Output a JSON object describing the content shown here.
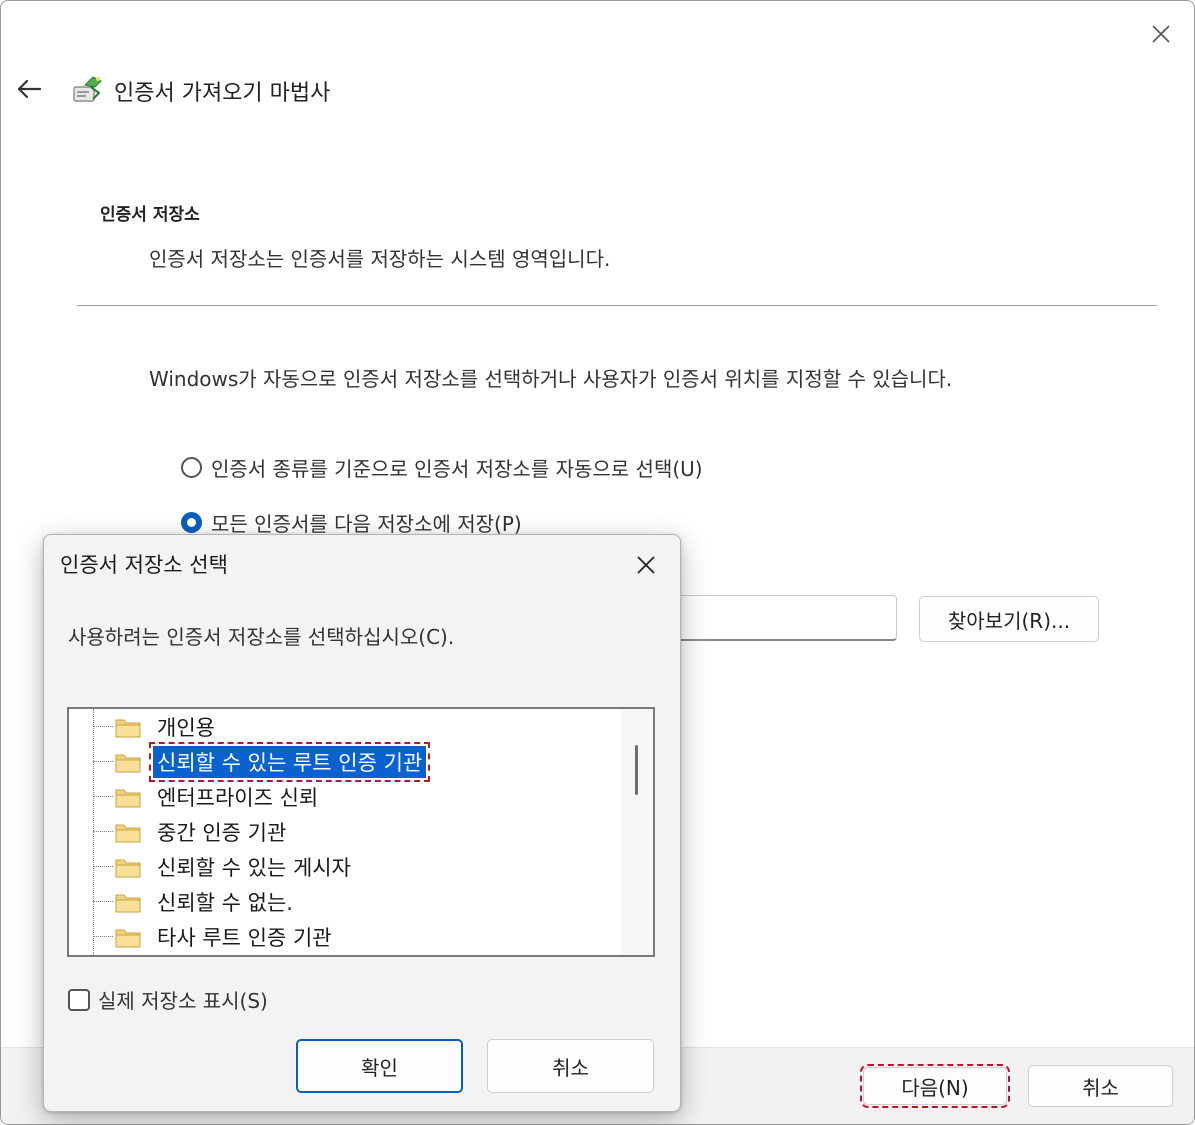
{
  "wizard": {
    "title": "인증서 가져오기 마법사",
    "section_title": "인증서 저장소",
    "section_desc": "인증서 저장소는 인증서를 저장하는 시스템 영역입니다.",
    "body_text": "Windows가 자동으로 인증서 저장소를 선택하거나 사용자가 인증서 위치를 지정할 수 있습니다.",
    "radio_auto": "인증서 종류를 기준으로 인증서 저장소를 자동으로 선택(U)",
    "radio_manual": "모든 인증서를 다음 저장소에 저장(P)",
    "browse_button": "찾아보기(R)...",
    "next_button": "다음(N)",
    "cancel_button": "취소",
    "icons": {
      "back": "back-arrow-icon",
      "close": "close-icon",
      "wizard": "certificate-wizard-icon"
    }
  },
  "dialog": {
    "title": "인증서 저장소 선택",
    "instruction": "사용하려는 인증서 저장소를 선택하십시오(C).",
    "stores": [
      "개인용",
      "신뢰할 수 있는 루트 인증 기관",
      "엔터프라이즈 신뢰",
      "중간 인증 기관",
      "신뢰할 수 있는 게시자",
      "신뢰할 수 없는.",
      "타사 루트 인증 기관"
    ],
    "selected_store": "신뢰할 수 있는 루트 인증 기관",
    "show_physical": "실제 저장소 표시(S)",
    "ok_button": "확인",
    "cancel_button": "취소"
  },
  "colors": {
    "selection": "#0a62d0",
    "accent": "#0a5ec2",
    "highlight_box": "#c0102a",
    "folder": "#f4d27a"
  }
}
